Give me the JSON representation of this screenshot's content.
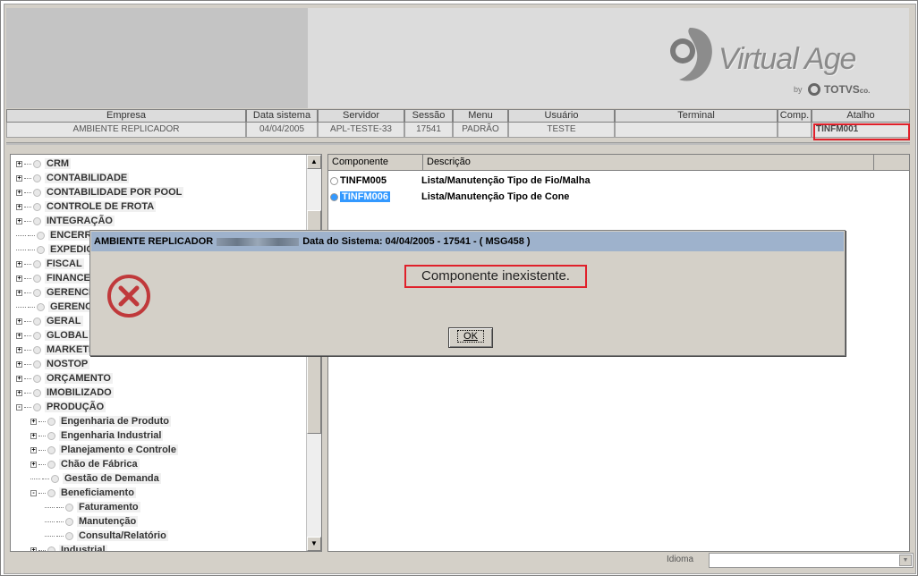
{
  "brand": {
    "name": "Virtual Age",
    "by": "by",
    "partner": "TOTVS",
    "partner_suffix": "co."
  },
  "info": {
    "headers": [
      "Empresa",
      "Data sistema",
      "Servidor",
      "Sessão",
      "Menu",
      "Usuário",
      "Terminal",
      "Comp.",
      "Atalho"
    ],
    "values": [
      "AMBIENTE REPLICADOR",
      "04/04/2005",
      "APL-TESTE-33",
      "17541",
      "PADRÃO",
      "TESTE",
      "",
      "",
      "TINFM001"
    ]
  },
  "tree": {
    "items": [
      {
        "label": "CRM",
        "expander": "+"
      },
      {
        "label": "CONTABILIDADE",
        "expander": "+"
      },
      {
        "label": "CONTABILIDADE POR POOL",
        "expander": "+"
      },
      {
        "label": "CONTROLE DE FROTA",
        "expander": "+"
      },
      {
        "label": "INTEGRAÇÃO",
        "expander": "+"
      },
      {
        "label": "ENCERRAI",
        "expander": ""
      },
      {
        "label": "EXPEDIÇÃ",
        "expander": ""
      },
      {
        "label": "FISCAL",
        "expander": "+"
      },
      {
        "label": "FINANCEIR",
        "expander": "+"
      },
      {
        "label": "GERENCIA",
        "expander": "+"
      },
      {
        "label": "GERENCIA",
        "expander": ""
      },
      {
        "label": "GERAL",
        "expander": "+"
      },
      {
        "label": "GLOBAL",
        "expander": "+"
      },
      {
        "label": "MARKETIN",
        "expander": "+"
      },
      {
        "label": "NOSTOP",
        "expander": "+"
      },
      {
        "label": "ORÇAMENTO",
        "expander": "+"
      },
      {
        "label": "IMOBILIZADO",
        "expander": "+"
      },
      {
        "label": "PRODUÇÃO",
        "expander": "-"
      },
      {
        "label": "Engenharia de Produto",
        "expander": "+",
        "level": 1
      },
      {
        "label": "Engenharia Industrial",
        "expander": "+",
        "level": 1
      },
      {
        "label": "Planejamento e Controle",
        "expander": "+",
        "level": 1
      },
      {
        "label": "Chão de Fábrica",
        "expander": "+",
        "level": 1
      },
      {
        "label": "Gestão de Demanda",
        "expander": "",
        "level": 1
      },
      {
        "label": "Beneficiamento",
        "expander": "-",
        "level": 1
      },
      {
        "label": "Faturamento",
        "expander": "",
        "level": 2
      },
      {
        "label": "Manutenção",
        "expander": "",
        "level": 2
      },
      {
        "label": "Consulta/Relatório",
        "expander": "",
        "level": 2
      },
      {
        "label": "Industrial",
        "expander": "+",
        "level": 1
      }
    ]
  },
  "list": {
    "headers": [
      "Componente",
      "Descrição"
    ],
    "rows": [
      {
        "code": "TINFM005",
        "description": "Lista/Manutenção Tipo de Fio/Malha",
        "selected": false
      },
      {
        "code": "TINFM006",
        "description": "Lista/Manutenção Tipo de Cone",
        "selected": true
      }
    ]
  },
  "status": {
    "language_label": "Idioma",
    "language_value": ""
  },
  "dialog": {
    "title_prefix": "AMBIENTE REPLICADOR",
    "title_suffix": "Data do Sistema: 04/04/2005 - 17541 - ( MSG458 )",
    "message": "Componente inexistente.",
    "ok_label": "OK",
    "icon": "error-icon",
    "icon_color": "#c0393b"
  }
}
